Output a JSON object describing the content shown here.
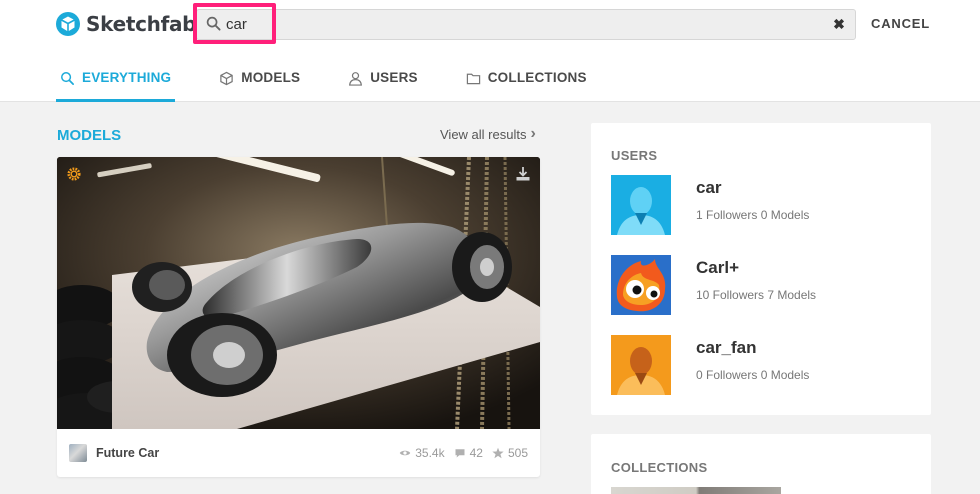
{
  "header": {
    "logo_text": "Sketchfab",
    "search_value": "car",
    "clear_label": "✖",
    "cancel_label": "CANCEL"
  },
  "tabs": [
    {
      "label": "EVERYTHING",
      "icon": "search-icon",
      "active": true
    },
    {
      "label": "MODELS",
      "icon": "cube-icon",
      "active": false
    },
    {
      "label": "USERS",
      "icon": "user-icon",
      "active": false
    },
    {
      "label": "COLLECTIONS",
      "icon": "folder-icon",
      "active": false
    }
  ],
  "models_section": {
    "title": "MODELS",
    "view_all_label": "View all results",
    "cards": [
      {
        "name": "Future Car",
        "views": "35.4k",
        "comments": "42",
        "likes": "505"
      }
    ]
  },
  "users_section": {
    "title": "USERS",
    "users": [
      {
        "name": "car",
        "meta": "1 Followers 0 Models",
        "avatar_color": "#1aaee3"
      },
      {
        "name": "Carl+",
        "meta": "10 Followers 7 Models",
        "avatar_color": "#2a6fc9"
      },
      {
        "name": "car_fan",
        "meta": "0 Followers 0 Models",
        "avatar_color": "#f49a1c"
      }
    ]
  },
  "collections_section": {
    "title": "COLLECTIONS"
  },
  "colors": {
    "accent": "#1caad9",
    "highlight": "#ff1f7a"
  }
}
